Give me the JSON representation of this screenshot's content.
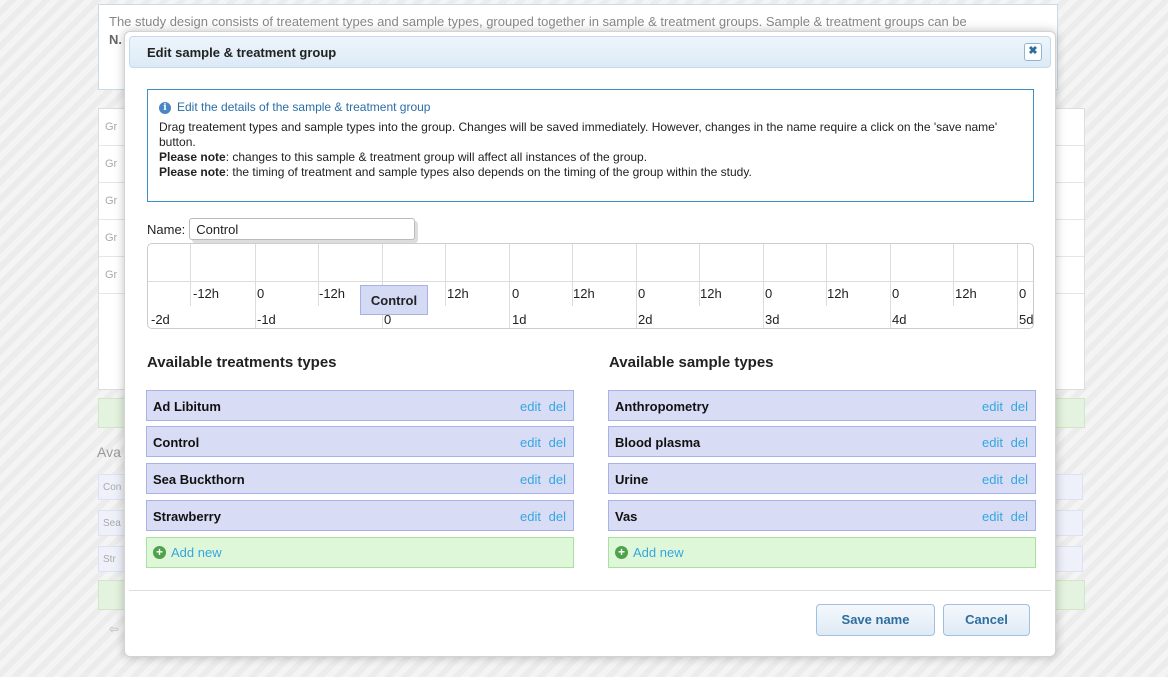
{
  "background": {
    "intro_text": "The study design consists of treatement types and sample types, grouped together in sample & treatment groups. Sample & treatment groups can be",
    "intro_note": "N.",
    "group_stub": "Gr",
    "available_stub": "Ava",
    "treatment_stubs": [
      "Con",
      "Sea",
      "Str"
    ]
  },
  "modal": {
    "title": "Edit sample & treatment group",
    "close_glyph": "✖",
    "info": {
      "icon_glyph": "i",
      "heading": "Edit the details of the sample & treatment group",
      "line1": "Drag treatement types and sample types into the group. Changes will be saved immediately. However, changes in the name require a click on the 'save name' button.",
      "note_label": "Please note",
      "note1": ": changes to this sample & treatment group will affect all instances of the group.",
      "note2": ": the timing of treatment and sample types also depends on the timing of the group within the study."
    },
    "name_label": "Name:",
    "name_value": "Control",
    "timeline": {
      "hour_ticks": [
        "-12h",
        "0",
        "-12h",
        "12h",
        "0",
        "12h",
        "0",
        "12h",
        "0",
        "12h",
        "0",
        "12h",
        "0"
      ],
      "day_labels": [
        "-2d",
        "-1d",
        "0",
        "1d",
        "2d",
        "3d",
        "4d",
        "5d"
      ],
      "group_label": "Control"
    },
    "treatments": {
      "heading": "Available treatments types",
      "items": [
        "Ad Libitum",
        "Control",
        "Sea Buckthorn",
        "Strawberry"
      ],
      "add_label": "Add new"
    },
    "samples": {
      "heading": "Available sample types",
      "items": [
        "Anthropometry",
        "Blood plasma",
        "Urine",
        "Vas"
      ],
      "add_label": "Add new"
    },
    "edit_label": "edit",
    "del_label": "del",
    "save_button": "Save name",
    "cancel_button": "Cancel"
  }
}
